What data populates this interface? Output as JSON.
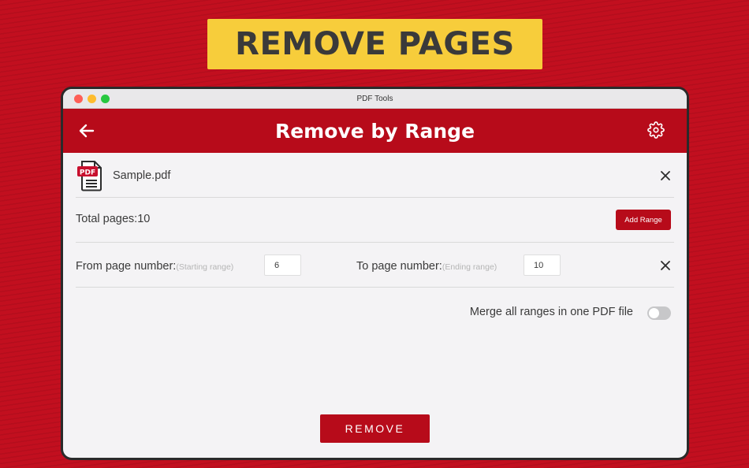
{
  "banner": {
    "title": "REMOVE PAGES"
  },
  "window": {
    "title": "PDF Tools"
  },
  "appbar": {
    "title": "Remove by Range",
    "icons": [
      "back-arrow-icon",
      "gear-icon"
    ]
  },
  "file": {
    "name": "Sample.pdf",
    "icon": "pdf-file-icon",
    "badge": "PDF"
  },
  "total": {
    "text": "Total pages:10",
    "add_range_label": "Add Range"
  },
  "range": {
    "from_label": "From page number:",
    "from_hint": "(Starting range)",
    "from_value": "6",
    "to_label": "To page number:",
    "to_hint": "(Ending range)",
    "to_value": "10"
  },
  "merge": {
    "label": "Merge all ranges in one PDF file",
    "enabled": false
  },
  "remove_label": "REMOVE",
  "colors": {
    "brand_red": "#b70b1a",
    "banner_yellow": "#f7cd3b",
    "background": "#f4f3f5"
  }
}
